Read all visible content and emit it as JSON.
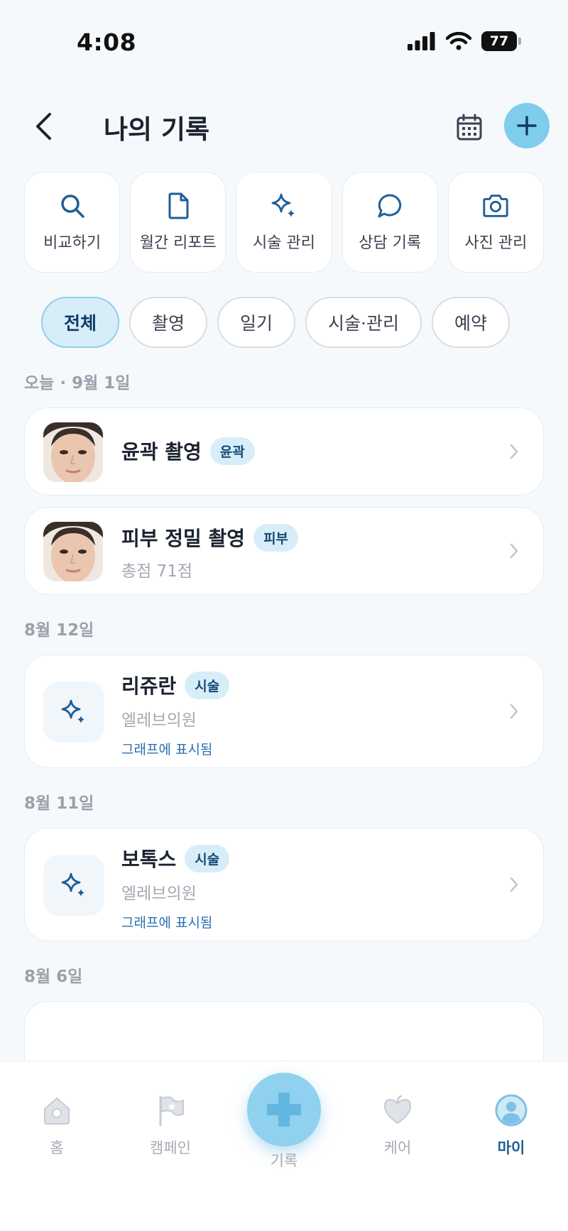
{
  "status_bar": {
    "time": "4:08",
    "battery": "77"
  },
  "header": {
    "title": "나의 기록"
  },
  "quick_actions": [
    {
      "label": "비교하기",
      "icon": "search-icon"
    },
    {
      "label": "월간 리포트",
      "icon": "document-icon"
    },
    {
      "label": "시술 관리",
      "icon": "sparkle-icon"
    },
    {
      "label": "상담 기록",
      "icon": "chat-bubble-icon"
    },
    {
      "label": "사진 관리",
      "icon": "camera-icon"
    }
  ],
  "filters": [
    {
      "label": "전체",
      "active": true
    },
    {
      "label": "촬영",
      "active": false
    },
    {
      "label": "일기",
      "active": false
    },
    {
      "label": "시술·관리",
      "active": false
    },
    {
      "label": "예약",
      "active": false
    }
  ],
  "sections": [
    {
      "date": "오늘 · 9월 1일",
      "records": [
        {
          "title": "윤곽 촬영",
          "tag": "윤곽"
        },
        {
          "title": "피부 정밀 촬영",
          "tag": "피부",
          "subtitle": "총점 71점"
        }
      ]
    },
    {
      "date": "8월 12일",
      "records": [
        {
          "title": "리쥬란",
          "tag": "시술",
          "subtitle": "엘레브의원",
          "link": "그래프에 표시됨"
        }
      ]
    },
    {
      "date": "8월 11일",
      "records": [
        {
          "title": "보톡스",
          "tag": "시술",
          "subtitle": "엘레브의원",
          "link": "그래프에 표시됨"
        }
      ]
    },
    {
      "date": "8월 6일"
    }
  ],
  "bottom_nav": [
    {
      "label": "홈",
      "icon": "home-icon"
    },
    {
      "label": "캠페인",
      "icon": "flag-icon"
    },
    {
      "label": "기록",
      "icon": "plus-icon"
    },
    {
      "label": "케어",
      "icon": "heart-icon"
    },
    {
      "label": "마이",
      "icon": "profile-icon",
      "active": true
    }
  ],
  "colors": {
    "accent": "#7fccec",
    "accent_dark": "#1f5e96",
    "tag_bg": "#d7eef9",
    "background": "#f6f9fc"
  }
}
